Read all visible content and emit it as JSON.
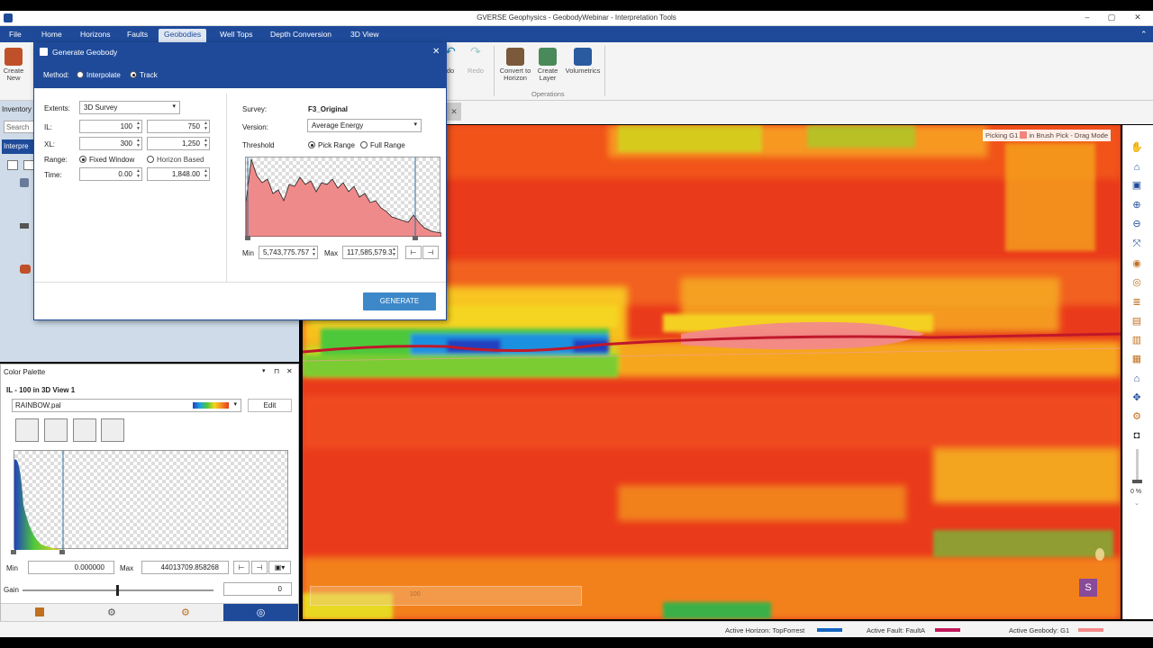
{
  "window": {
    "title": "GVERSE Geophysics - GeobodyWebinar - Interpretation Tools"
  },
  "menu": [
    "File",
    "Home",
    "Horizons",
    "Faults",
    "Geobodies",
    "Well Tops",
    "Depth Conversion",
    "3D View"
  ],
  "menu_active": "Geobodies",
  "ribbon": {
    "create_new": "Create New",
    "redo": "Redo",
    "undo": "do",
    "convert_to_horizon": "Convert to Horizon",
    "create_layer": "Create Layer",
    "volumetrics": "Volumetrics",
    "group_operations": "Operations"
  },
  "left_panel": {
    "inventory_tab": "Inventory",
    "search_placeholder": "Search",
    "interpretation_tab": "Interpre"
  },
  "dialog": {
    "title": "Generate Geobody",
    "method_label": "Method:",
    "method_interpolate": "Interpolate",
    "method_track": "Track",
    "extents_label": "Extents:",
    "extents_value": "3D Survey",
    "il_label": "IL:",
    "il_from": "100",
    "il_to": "750",
    "xl_label": "XL:",
    "xl_from": "300",
    "xl_to": "1,250",
    "range_label": "Range:",
    "range_fixed": "Fixed Window",
    "range_horizon": "Horizon Based",
    "time_label": "Time:",
    "time_from": "0.00",
    "time_to": "1,848.00",
    "survey_label": "Survey:",
    "survey_value": "F3_Original",
    "version_label": "Version:",
    "version_value": "Average Energy",
    "threshold_label": "Threshold",
    "threshold_pick": "Pick Range",
    "threshold_full": "Full Range",
    "min_label": "Min",
    "min_value": "5,743,775.757",
    "max_label": "Max",
    "max_value": "117,585,579.3",
    "generate_button": "GENERATE"
  },
  "viewport": {
    "overlay_prefix": "Picking G1",
    "overlay_suffix": "in Brush Pick - Drag Mode",
    "overlay_value": "100",
    "zoom": "0 %",
    "badge": "S"
  },
  "palette": {
    "panel_title": "Color Palette",
    "view_label": "IL - 100 in 3D View 1",
    "palette_name": "RAINBOW.pal",
    "edit_button": "Edit",
    "min_label": "Min",
    "min_value": "0.000000",
    "max_label": "Max",
    "max_value": "44013709.858268",
    "gain_label": "Gain",
    "gain_value": "0"
  },
  "status": {
    "horizon": "Active Horizon: TopForrest",
    "fault": "Active Fault: FaultA",
    "geobody": "Active Geobody: G1",
    "horizon_color": "#1565c0",
    "fault_color": "#c2185b",
    "geobody_color": "#f48a8a"
  }
}
